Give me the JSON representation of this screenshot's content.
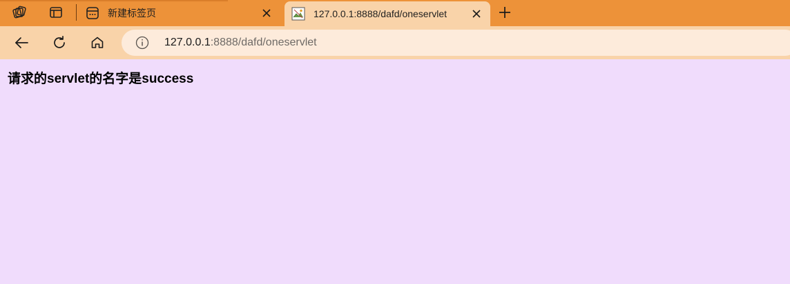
{
  "browser": {
    "tabs": [
      {
        "title": "新建标签页",
        "active": false
      },
      {
        "title": "127.0.0.1:8888/dafd/oneservlet",
        "active": true
      }
    ],
    "address_bar": {
      "host": "127.0.0.1",
      "rest": ":8888/dafd/oneservlet"
    }
  },
  "page": {
    "heading": "请求的servlet的名字是success"
  },
  "icons": {
    "workspaces": "workspaces-icon",
    "tab_actions": "tab-actions-icon",
    "new_tab_page": "new-tab-page-icon",
    "broken_image": "broken-image-favicon",
    "close": "close-icon",
    "plus": "plus-icon",
    "back": "back-arrow-icon",
    "refresh": "refresh-icon",
    "home": "home-icon",
    "info": "info-icon"
  },
  "colors": {
    "tab_strip": "#ed9239",
    "active_tab": "#f9d3a9",
    "toolbar": "#f9d3a9",
    "address_bar": "#fdebdb",
    "page_background": "#f0dcfc"
  }
}
